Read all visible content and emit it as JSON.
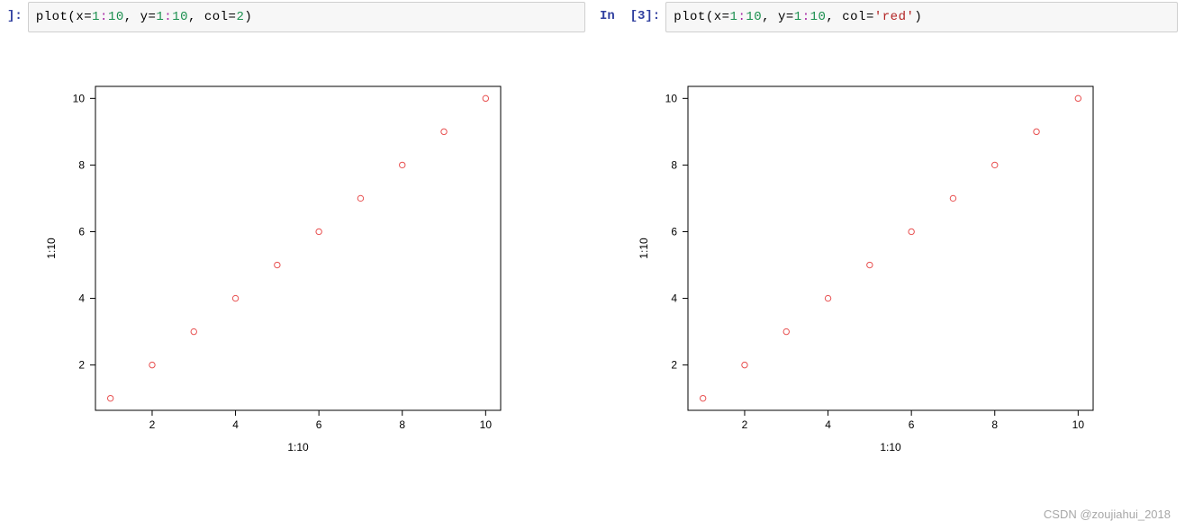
{
  "cells": [
    {
      "prompt_prefix": "",
      "prompt_bracket": "]:",
      "code": {
        "fn": "plot",
        "args_display": "(x=1:10, y=1:10, col=2)",
        "tokens": [
          {
            "t": "fn",
            "v": "plot"
          },
          {
            "t": "paren",
            "v": "("
          },
          {
            "t": "arg",
            "v": "x"
          },
          {
            "t": "eq",
            "v": "="
          },
          {
            "t": "num",
            "v": "1"
          },
          {
            "t": "op",
            "v": ":"
          },
          {
            "t": "num",
            "v": "10"
          },
          {
            "t": "paren",
            "v": ", "
          },
          {
            "t": "arg",
            "v": "y"
          },
          {
            "t": "eq",
            "v": "="
          },
          {
            "t": "num",
            "v": "1"
          },
          {
            "t": "op",
            "v": ":"
          },
          {
            "t": "num",
            "v": "10"
          },
          {
            "t": "paren",
            "v": ", "
          },
          {
            "t": "arg",
            "v": "col"
          },
          {
            "t": "eq",
            "v": "="
          },
          {
            "t": "num",
            "v": "2"
          },
          {
            "t": "paren",
            "v": ")"
          }
        ]
      }
    },
    {
      "prompt_prefix": "In  [3]:",
      "prompt_bracket": "",
      "code": {
        "fn": "plot",
        "args_display": "(x=1:10, y=1:10, col='red')",
        "tokens": [
          {
            "t": "fn",
            "v": "plot"
          },
          {
            "t": "paren",
            "v": "("
          },
          {
            "t": "arg",
            "v": "x"
          },
          {
            "t": "eq",
            "v": "="
          },
          {
            "t": "num",
            "v": "1"
          },
          {
            "t": "op",
            "v": ":"
          },
          {
            "t": "num",
            "v": "10"
          },
          {
            "t": "paren",
            "v": ", "
          },
          {
            "t": "arg",
            "v": "y"
          },
          {
            "t": "eq",
            "v": "="
          },
          {
            "t": "num",
            "v": "1"
          },
          {
            "t": "op",
            "v": ":"
          },
          {
            "t": "num",
            "v": "10"
          },
          {
            "t": "paren",
            "v": ", "
          },
          {
            "t": "arg",
            "v": "col"
          },
          {
            "t": "eq",
            "v": "="
          },
          {
            "t": "str",
            "v": "'red'"
          },
          {
            "t": "paren",
            "v": ")"
          }
        ]
      }
    }
  ],
  "chart_data": [
    {
      "type": "scatter",
      "x": [
        1,
        2,
        3,
        4,
        5,
        6,
        7,
        8,
        9,
        10
      ],
      "y": [
        1,
        2,
        3,
        4,
        5,
        6,
        7,
        8,
        9,
        10
      ],
      "xlabel": "1:10",
      "ylabel": "1:10",
      "xticks": [
        2,
        4,
        6,
        8,
        10
      ],
      "yticks": [
        2,
        4,
        6,
        8,
        10
      ],
      "xlim": [
        0.64,
        10.36
      ],
      "ylim": [
        0.64,
        10.36
      ],
      "point_color": "#e85151"
    },
    {
      "type": "scatter",
      "x": [
        1,
        2,
        3,
        4,
        5,
        6,
        7,
        8,
        9,
        10
      ],
      "y": [
        1,
        2,
        3,
        4,
        5,
        6,
        7,
        8,
        9,
        10
      ],
      "xlabel": "1:10",
      "ylabel": "1:10",
      "xticks": [
        2,
        4,
        6,
        8,
        10
      ],
      "yticks": [
        2,
        4,
        6,
        8,
        10
      ],
      "xlim": [
        0.64,
        10.36
      ],
      "ylim": [
        0.64,
        10.36
      ],
      "point_color": "#e85151"
    }
  ],
  "watermark": "CSDN @zoujiahui_2018"
}
